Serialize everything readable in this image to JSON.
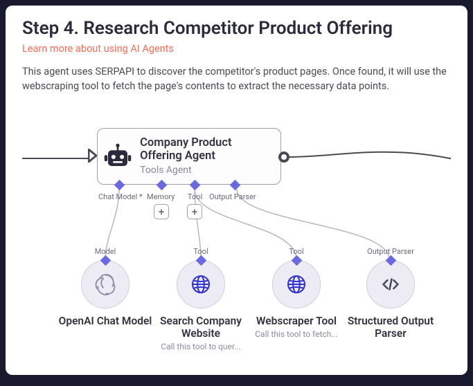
{
  "header": {
    "title": "Step 4. Research Competitor Product Offering",
    "link": "Learn more about using AI Agents",
    "description": "This agent uses SERPAPI to discover the competitor's product pages. Once found, it will use the webscraping tool to fetch the page's contents to extract the necessary data points."
  },
  "agent": {
    "name": "Company Product Offering Agent",
    "subtitle": "Tools Agent",
    "ports": {
      "chat_model": "Chat Model *",
      "memory": "Memory",
      "tool": "Tool",
      "output_parser": "Output Parser"
    }
  },
  "nodes": {
    "model": {
      "port_label": "Model",
      "name": "OpenAI Chat Model",
      "hint": ""
    },
    "search": {
      "port_label": "Tool",
      "name": "Search Company Website",
      "hint": "Call this tool to quer..."
    },
    "scraper": {
      "port_label": "Tool",
      "name": "Webscraper Tool",
      "hint": "Call this tool to fetch..."
    },
    "parser": {
      "port_label": "Output Parser",
      "name": "Structured Output Parser",
      "hint": ""
    }
  }
}
